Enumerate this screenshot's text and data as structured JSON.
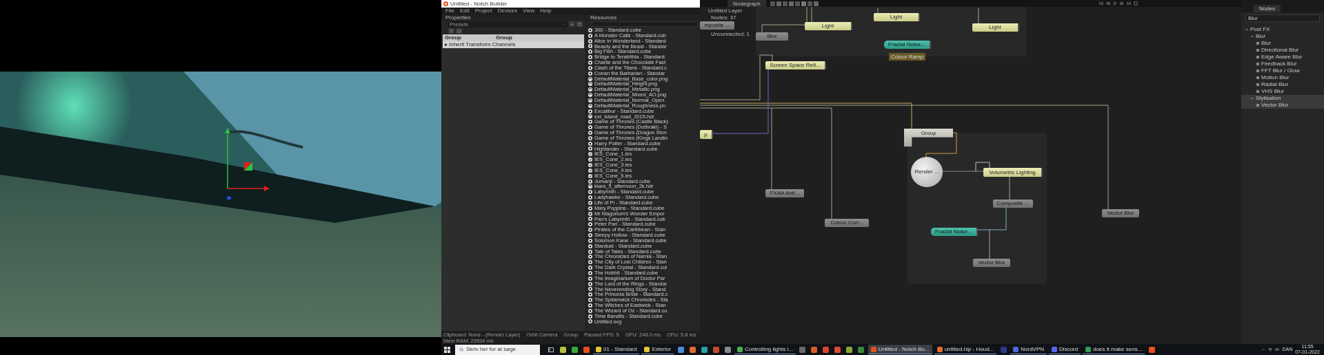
{
  "window": {
    "title": "Untitled - Notch Builder",
    "menu": [
      "File",
      "Edit",
      "Project",
      "Devices",
      "View",
      "Help"
    ]
  },
  "properties": {
    "title": "Properties",
    "presets": {
      "placeholder": "Presets"
    },
    "columns": [
      "Group",
      "Group"
    ],
    "rows": [
      {
        "label": "Inherit Transform Channels",
        "expanded": false
      }
    ]
  },
  "resources": {
    "title": "Resources",
    "items": [
      {
        "name": "300 - Standard.cube",
        "kind": "lut"
      },
      {
        "name": "A Monster Calls - Standard.cub",
        "kind": "lut"
      },
      {
        "name": "Alice in Wonderland - Standard",
        "kind": "lut"
      },
      {
        "name": "Beauty and the Beast - Standar",
        "kind": "lut"
      },
      {
        "name": "Big Fish - Standard.cube",
        "kind": "lut"
      },
      {
        "name": "Bridge to Terabithia - Standard.",
        "kind": "lut"
      },
      {
        "name": "Charlie and the Chocolate Fact",
        "kind": "lut"
      },
      {
        "name": "Clash of the Titans - Standard.c",
        "kind": "lut"
      },
      {
        "name": "Conan the Barbarian - Standar",
        "kind": "lut"
      },
      {
        "name": "DefaultMaterial_Base_color.png",
        "kind": "image"
      },
      {
        "name": "DefaultMaterial_Height.png",
        "kind": "image"
      },
      {
        "name": "DefaultMaterial_Metallic.png",
        "kind": "image"
      },
      {
        "name": "DefaultMaterial_Mixed_AO.png",
        "kind": "image"
      },
      {
        "name": "DefaultMaterial_Normal_Open",
        "kind": "image"
      },
      {
        "name": "DefaultMaterial_Roughness.pn",
        "kind": "image"
      },
      {
        "name": "Excalibur - Standard.cube",
        "kind": "lut"
      },
      {
        "name": "ext_island_road_2015.hdr",
        "kind": "image"
      },
      {
        "name": "Game of Thrones (Castle Black)",
        "kind": "lut"
      },
      {
        "name": "Game of Thrones (Dothraki) - S",
        "kind": "lut"
      },
      {
        "name": "Game of Thrones (Dragon Ston",
        "kind": "lut"
      },
      {
        "name": "Game of Thrones (Kings Landin",
        "kind": "lut"
      },
      {
        "name": "Harry Potter - Standard.cube",
        "kind": "lut"
      },
      {
        "name": "Highlander - Standard.cube",
        "kind": "lut"
      },
      {
        "name": "IES_Cone_1.ies",
        "kind": "ies"
      },
      {
        "name": "IES_Cone_2.ies",
        "kind": "ies"
      },
      {
        "name": "IES_Cone_3.ies",
        "kind": "ies"
      },
      {
        "name": "IES_Cone_4.ies",
        "kind": "ies"
      },
      {
        "name": "IES_Cone_5.ies",
        "kind": "ies"
      },
      {
        "name": "Jumanji - Standard.cube",
        "kind": "lut"
      },
      {
        "name": "kiara_5_afternoon_2k.hdr",
        "kind": "image"
      },
      {
        "name": "Labyrinth - Standard.cube",
        "kind": "lut"
      },
      {
        "name": "Ladyhawke - Standard.cube",
        "kind": "lut"
      },
      {
        "name": "Life of Pi - Standard.cube",
        "kind": "lut"
      },
      {
        "name": "Mary Poppins - Standard.cube",
        "kind": "lut"
      },
      {
        "name": "Mr Magorium's Wonder Empor",
        "kind": "lut"
      },
      {
        "name": "Pan's Labyrinth - Standard.cub",
        "kind": "lut"
      },
      {
        "name": "Peter Pan - Standard.cube",
        "kind": "lut"
      },
      {
        "name": "Pirates of the Caribbean - Stan",
        "kind": "lut"
      },
      {
        "name": "Sleepy Hollow - Standard.cube",
        "kind": "lut"
      },
      {
        "name": "Solomon Kane - Standard.cube",
        "kind": "lut"
      },
      {
        "name": "Stardust - Standard.cube",
        "kind": "lut"
      },
      {
        "name": "Tale of Tales - Standard.cube",
        "kind": "lut"
      },
      {
        "name": "The Chronicles of Narnia - Stan",
        "kind": "lut"
      },
      {
        "name": "The City of Lost Children - Stan",
        "kind": "lut"
      },
      {
        "name": "The Dark Crystal - Standard.cul",
        "kind": "lut"
      },
      {
        "name": "The Hobbit - Standard.cube",
        "kind": "lut"
      },
      {
        "name": "The Imaginarium of Doctor Par",
        "kind": "lut"
      },
      {
        "name": "The Lord of the Rings - Standar",
        "kind": "lut"
      },
      {
        "name": "The Neverending Story - Stand",
        "kind": "lut"
      },
      {
        "name": "The Princess Bride - Standard.c",
        "kind": "lut"
      },
      {
        "name": "The Spiderwick Chronicles - Sta",
        "kind": "lut"
      },
      {
        "name": "The Witches of Eastwick - Stan",
        "kind": "lut"
      },
      {
        "name": "The Wizard of Oz - Standard.cu",
        "kind": "lut"
      },
      {
        "name": "Time Bandits - Standard.cube",
        "kind": "lut"
      },
      {
        "name": "Untitled.svg",
        "kind": "mesh"
      }
    ]
  },
  "status_bar": [
    "Clipboard: None - (Render Layer)",
    "Orbit Camera",
    "Group",
    "Paused FPS: 5",
    "GPU: 248.0 ms",
    "CPU: 5.8 ms",
    "Mem RAM: 29534 mb"
  ],
  "nodegraph": {
    "tab": "Nodegraph",
    "layer": {
      "title": "Untitled Layer",
      "nodes": "Nodes: 37",
      "unconnected": "Unconnected: 1"
    },
    "nodes": [
      {
        "label": "mposite ...",
        "kind": "post"
      },
      {
        "label": "Light",
        "kind": "standard"
      },
      {
        "label": "Light",
        "kind": "standard"
      },
      {
        "label": "Light",
        "kind": "standard"
      },
      {
        "label": "Blur",
        "kind": "post"
      },
      {
        "label": "Fractal Noise...",
        "kind": "generator",
        "tooltip": "Colour Ramp"
      },
      {
        "label": "Screen Space Refl...",
        "kind": "standard"
      },
      {
        "label": "p",
        "kind": "standard"
      },
      {
        "label": "Group",
        "kind": "group"
      },
      {
        "label": "Render ...",
        "kind": "render"
      },
      {
        "label": "Volumetric Lighting",
        "kind": "standard"
      },
      {
        "label": "Composite ...",
        "kind": "post"
      },
      {
        "label": "Fractal Noise...",
        "kind": "generator"
      },
      {
        "label": "Vector Blur",
        "kind": "post"
      },
      {
        "label": "FXAA Anti...",
        "kind": "post"
      },
      {
        "label": "Colour Corr...",
        "kind": "post"
      },
      {
        "label": "Vector Blur",
        "kind": "post"
      }
    ]
  },
  "nodes_panel": {
    "tab": "Nodes",
    "search": "Blur",
    "tree": [
      {
        "label": "Post FX",
        "expanded": true,
        "selected": false,
        "children": [
          {
            "label": "Blur",
            "expanded": true,
            "selected": false,
            "children": [
              {
                "label": "Blur",
                "selected": false
              },
              {
                "label": "Directional Blur",
                "selected": false
              },
              {
                "label": "Edge Aware Blur",
                "selected": false
              },
              {
                "label": "Feedback Blur",
                "selected": false
              },
              {
                "label": "FFT Blur / Glow",
                "selected": false
              },
              {
                "label": "Motion Blur",
                "selected": false
              },
              {
                "label": "Radial Blur",
                "selected": false
              },
              {
                "label": "VHS Blur",
                "selected": false
              }
            ]
          },
          {
            "label": "Stylisation",
            "expanded": true,
            "selected": true,
            "children": [
              {
                "label": "Vector Blur",
                "selected": true
              }
            ]
          }
        ]
      }
    ]
  },
  "taskbar": {
    "search": {
      "placeholder": "Skriv her for at søge"
    },
    "items": [
      {
        "kind": "taskview",
        "selected": false
      },
      {
        "kind": "icon",
        "color": "#b8c040",
        "selected": false
      },
      {
        "kind": "icon",
        "color": "#3aa83a",
        "selected": false
      },
      {
        "kind": "icon",
        "color": "#e8501a",
        "selected": false
      },
      {
        "kind": "window",
        "label": "01 - Standard",
        "color": "#e8c23a",
        "selected": false
      },
      {
        "kind": "window",
        "label": "Exterior",
        "color": "#e8c23a",
        "selected": false
      },
      {
        "kind": "icon",
        "color": "#4a8fd8",
        "selected": false
      },
      {
        "kind": "icon",
        "color": "#e06a2a",
        "selected": false
      },
      {
        "kind": "icon",
        "color": "#2aa0a0",
        "selected": false
      },
      {
        "kind": "icon",
        "color": "#c84a2a",
        "selected": false
      },
      {
        "kind": "icon",
        "color": "#8a8a8a",
        "selected": false
      },
      {
        "kind": "window",
        "label": "Controlling lights i...",
        "color": "#4caf50",
        "selected": false
      },
      {
        "kind": "icon",
        "color": "#6a6a6a",
        "selected": false
      },
      {
        "kind": "icon",
        "color": "#d85a2a",
        "selected": false
      },
      {
        "kind": "icon",
        "color": "#d8442a",
        "selected": false
      },
      {
        "kind": "icon",
        "color": "#e04a3a",
        "selected": false
      },
      {
        "kind": "icon",
        "color": "#8aa83a",
        "selected": false
      },
      {
        "kind": "icon",
        "color": "#3a8a3a",
        "selected": false
      },
      {
        "kind": "window",
        "label": "Untitled - Notch Bu...",
        "color": "#e8501a",
        "selected": true
      },
      {
        "kind": "window",
        "label": "untitled.hip - Houd...",
        "color": "#e86a2a",
        "selected": false
      },
      {
        "kind": "icon",
        "color": "#2a3a8a",
        "selected": false
      },
      {
        "kind": "window",
        "label": "NordVPN",
        "color": "#4a6ad8",
        "selected": false
      },
      {
        "kind": "window",
        "label": "Discord",
        "color": "#5865f2",
        "selected": false
      },
      {
        "kind": "window",
        "label": "does it make sens...",
        "color": "#3a9a5a",
        "selected": false
      },
      {
        "kind": "icon",
        "color": "#e8501a",
        "selected": false
      }
    ],
    "tray": {
      "language": "DAN",
      "time": "11:55",
      "date": "07-01-2022"
    }
  }
}
